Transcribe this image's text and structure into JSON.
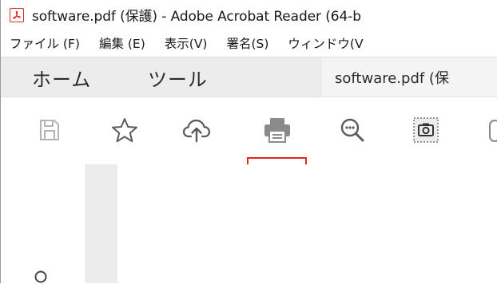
{
  "window": {
    "title": "software.pdf (保護) - Adobe Acrobat Reader (64-b",
    "app_icon": "adobe-reader-icon",
    "brand_color": "#d62b22"
  },
  "menubar": {
    "items": [
      {
        "label": "ファイル (F)"
      },
      {
        "label": "編集 (E)"
      },
      {
        "label": "表示(V)"
      },
      {
        "label": "署名(S)"
      },
      {
        "label": "ウィンドウ(V"
      }
    ]
  },
  "tabs": {
    "home": "ホーム",
    "tools": "ツール",
    "document": "software.pdf (保"
  },
  "toolbar": {
    "tools": [
      {
        "icon": "save-icon"
      },
      {
        "icon": "star-icon"
      },
      {
        "icon": "cloud-upload-icon"
      },
      {
        "icon": "print-icon",
        "highlighted": true
      },
      {
        "icon": "zoom-out-icon"
      },
      {
        "icon": "snapshot-icon"
      }
    ],
    "highlight_color": "#e2281c"
  },
  "sidepanel": {
    "visible_icon": "search-icon"
  }
}
